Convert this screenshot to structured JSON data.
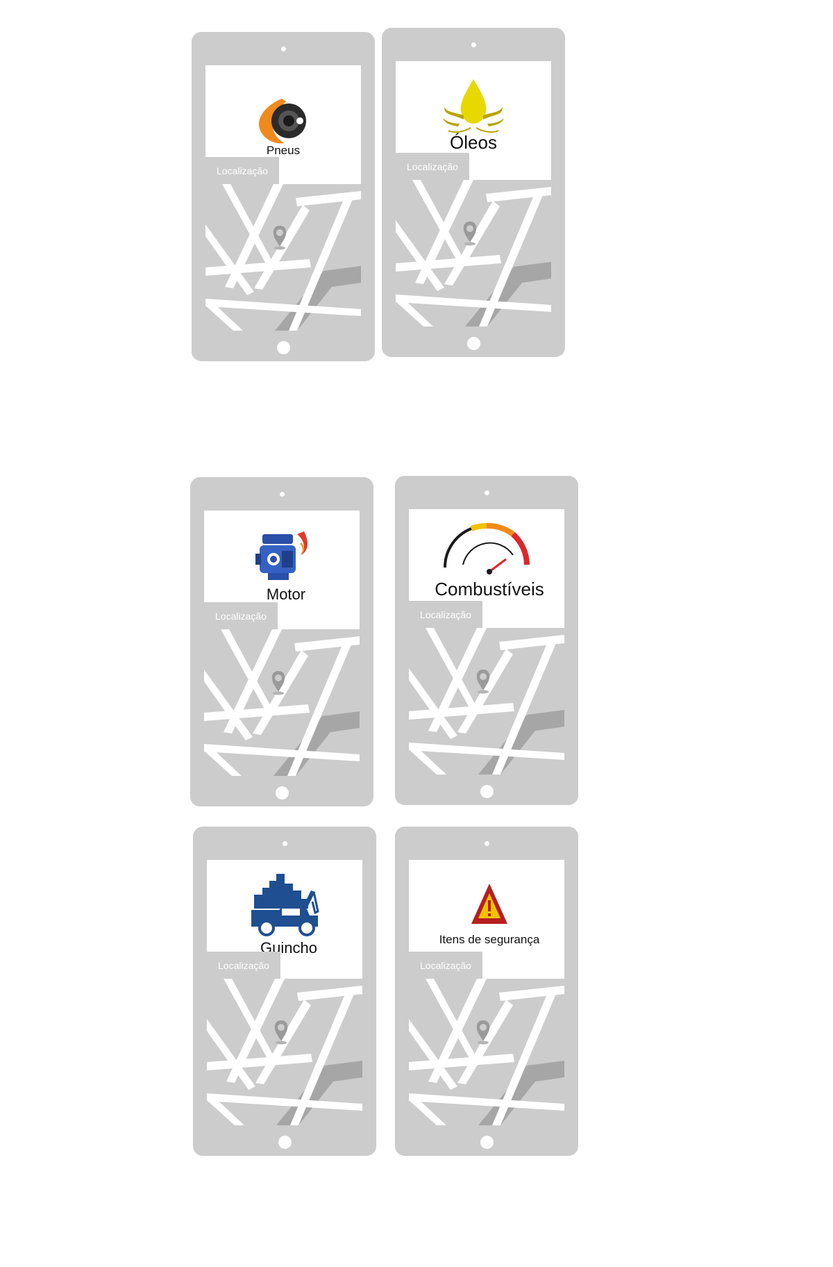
{
  "colors": {
    "device": "#cccccc",
    "screen_banner": "#ffffff",
    "map_road": "#ffffff",
    "map_highway": "#a6a6a6",
    "pin": "#9a9a9a",
    "brand_blue": "#1f4f91",
    "oil_yellow": "#e8d800",
    "warning_red": "#b51f1f"
  },
  "cards": [
    {
      "title": "Pneus",
      "logo_icon": "tire-flame-icon",
      "location_label": "Localização"
    },
    {
      "title": "Óleos",
      "logo_icon": "oil-drop-icon",
      "location_label": "Localização"
    },
    {
      "title": "Motor",
      "logo_icon": "engine-icon",
      "location_label": "Localização"
    },
    {
      "title": "Combustíveis",
      "logo_icon": "fuel-gauge-icon",
      "location_label": "Localização"
    },
    {
      "title": "Guincho",
      "logo_icon": "tow-truck-icon",
      "location_label": "Localização"
    },
    {
      "title": "Itens de segurança",
      "logo_icon": "warning-triangle-icon",
      "location_label": "Localização"
    }
  ]
}
